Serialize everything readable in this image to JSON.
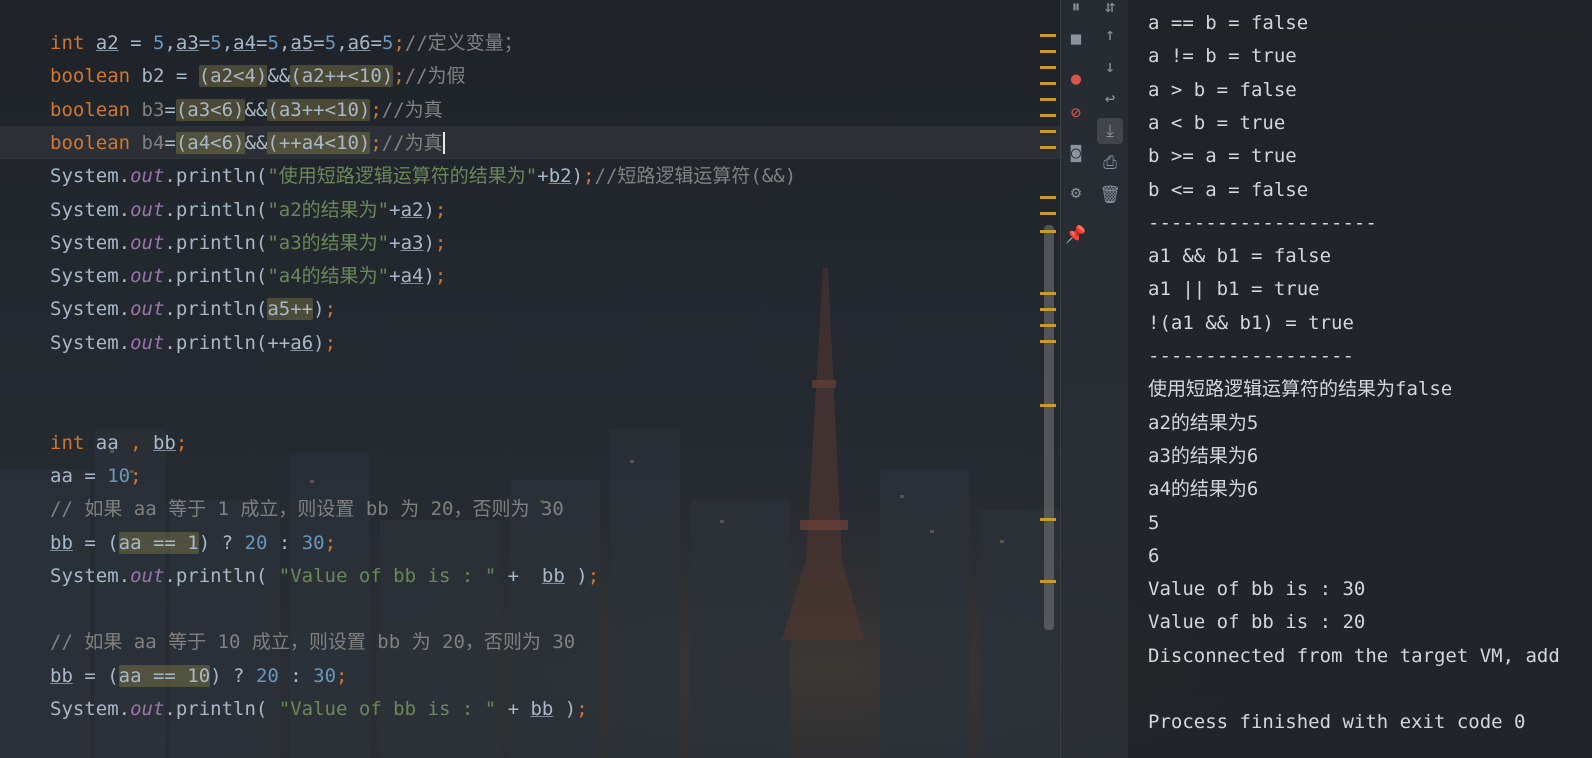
{
  "editor": {
    "lines": [
      {
        "tokens": [
          {
            "t": "int ",
            "c": "kw"
          },
          {
            "t": "a2",
            "c": "ul"
          },
          {
            "t": " = "
          },
          {
            "t": "5",
            "c": "num"
          },
          {
            "t": ","
          },
          {
            "t": "a3",
            "c": "ul"
          },
          {
            "t": "="
          },
          {
            "t": "5",
            "c": "num"
          },
          {
            "t": ","
          },
          {
            "t": "a4",
            "c": "ul"
          },
          {
            "t": "="
          },
          {
            "t": "5",
            "c": "num"
          },
          {
            "t": ","
          },
          {
            "t": "a5",
            "c": "ul"
          },
          {
            "t": "="
          },
          {
            "t": "5",
            "c": "num"
          },
          {
            "t": ","
          },
          {
            "t": "a6",
            "c": "ul"
          },
          {
            "t": "="
          },
          {
            "t": "5",
            "c": "num"
          },
          {
            "t": ";",
            "c": "kw"
          },
          {
            "t": "//定义变量；",
            "c": "cmt"
          }
        ]
      },
      {
        "tokens": [
          {
            "t": "boolean ",
            "c": "kw"
          },
          {
            "t": "b2 = "
          },
          {
            "t": "(a2<4)",
            "c": "hl"
          },
          {
            "t": "&&"
          },
          {
            "t": "(a2++<10)",
            "c": "hl"
          },
          {
            "t": ";",
            "c": "kw"
          },
          {
            "t": "//为假",
            "c": "cmt"
          }
        ]
      },
      {
        "tokens": [
          {
            "t": "boolean ",
            "c": "kw"
          },
          {
            "t": "b3",
            "c": "cmt"
          },
          {
            "t": "="
          },
          {
            "t": "(a3<6)",
            "c": "hl"
          },
          {
            "t": "&&"
          },
          {
            "t": "(a3++<10)",
            "c": "hl"
          },
          {
            "t": ";",
            "c": "kw"
          },
          {
            "t": "//为真",
            "c": "cmt"
          }
        ]
      },
      {
        "tokens": [
          {
            "t": "boolean ",
            "c": "kw"
          },
          {
            "t": "b4",
            "c": "cmt"
          },
          {
            "t": "="
          },
          {
            "t": "(a4<6)",
            "c": "hl"
          },
          {
            "t": "&&"
          },
          {
            "t": "(++a4<10)",
            "c": "hl"
          },
          {
            "t": ";",
            "c": "kw"
          },
          {
            "t": "//为真",
            "c": "cmt"
          },
          {
            "t": "",
            "c": "cursor"
          }
        ]
      },
      {
        "tokens": [
          {
            "t": "System."
          },
          {
            "t": "out",
            "c": "fld"
          },
          {
            "t": ".println("
          },
          {
            "t": "\"使用短路逻辑运算符的结果为\"",
            "c": "str"
          },
          {
            "t": "+"
          },
          {
            "t": "b2",
            "c": "ul"
          },
          {
            "t": ")"
          },
          {
            "t": ";",
            "c": "kw"
          },
          {
            "t": "//短路逻辑运算符(&&)",
            "c": "cmt"
          }
        ]
      },
      {
        "tokens": [
          {
            "t": "System."
          },
          {
            "t": "out",
            "c": "fld"
          },
          {
            "t": ".println("
          },
          {
            "t": "\"a2的结果为\"",
            "c": "str"
          },
          {
            "t": "+"
          },
          {
            "t": "a2",
            "c": "ul"
          },
          {
            "t": ")"
          },
          {
            "t": ";",
            "c": "kw"
          }
        ]
      },
      {
        "tokens": [
          {
            "t": "System."
          },
          {
            "t": "out",
            "c": "fld"
          },
          {
            "t": ".println("
          },
          {
            "t": "\"a3的结果为\"",
            "c": "str"
          },
          {
            "t": "+"
          },
          {
            "t": "a3",
            "c": "ul"
          },
          {
            "t": ")"
          },
          {
            "t": ";",
            "c": "kw"
          }
        ]
      },
      {
        "tokens": [
          {
            "t": "System."
          },
          {
            "t": "out",
            "c": "fld"
          },
          {
            "t": ".println("
          },
          {
            "t": "\"a4的结果为\"",
            "c": "str"
          },
          {
            "t": "+"
          },
          {
            "t": "a4",
            "c": "ul"
          },
          {
            "t": ")"
          },
          {
            "t": ";",
            "c": "kw"
          }
        ]
      },
      {
        "tokens": [
          {
            "t": "System."
          },
          {
            "t": "out",
            "c": "fld"
          },
          {
            "t": ".println("
          },
          {
            "t": "a5++",
            "c": "hl"
          },
          {
            "t": ")"
          },
          {
            "t": ";",
            "c": "kw"
          }
        ]
      },
      {
        "tokens": [
          {
            "t": "System."
          },
          {
            "t": "out",
            "c": "fld"
          },
          {
            "t": ".println(++"
          },
          {
            "t": "a6",
            "c": "ul"
          },
          {
            "t": ")"
          },
          {
            "t": ";",
            "c": "kw"
          }
        ]
      },
      {
        "tokens": []
      },
      {
        "tokens": []
      },
      {
        "tokens": [
          {
            "t": "int ",
            "c": "kw"
          },
          {
            "t": "aa "
          },
          {
            "t": ", ",
            "c": "kw"
          },
          {
            "t": "bb",
            "c": "ul"
          },
          {
            "t": ";",
            "c": "kw"
          }
        ]
      },
      {
        "tokens": [
          {
            "t": "aa = "
          },
          {
            "t": "10",
            "c": "num"
          },
          {
            "t": ";",
            "c": "kw"
          }
        ]
      },
      {
        "tokens": [
          {
            "t": "// 如果 aa 等于 1 成立，则设置 bb 为 20，否则为 30",
            "c": "cmt"
          }
        ]
      },
      {
        "tokens": [
          {
            "t": "bb",
            "c": "ul"
          },
          {
            "t": " = ("
          },
          {
            "t": "aa == 1",
            "c": "hl"
          },
          {
            "t": ") ? "
          },
          {
            "t": "20",
            "c": "num"
          },
          {
            "t": " : "
          },
          {
            "t": "30",
            "c": "num"
          },
          {
            "t": ";",
            "c": "kw"
          }
        ]
      },
      {
        "tokens": [
          {
            "t": "System."
          },
          {
            "t": "out",
            "c": "fld"
          },
          {
            "t": ".println( "
          },
          {
            "t": "\"Value of bb is : \"",
            "c": "str"
          },
          {
            "t": " +  "
          },
          {
            "t": "bb",
            "c": "ul"
          },
          {
            "t": " )"
          },
          {
            "t": ";",
            "c": "kw"
          }
        ]
      },
      {
        "tokens": []
      },
      {
        "tokens": [
          {
            "t": "// 如果 aa 等于 10 成立，则设置 bb 为 20，否则为 30",
            "c": "cmt"
          }
        ]
      },
      {
        "tokens": [
          {
            "t": "bb",
            "c": "ul"
          },
          {
            "t": " = ("
          },
          {
            "t": "aa == 10",
            "c": "hl"
          },
          {
            "t": ") ? "
          },
          {
            "t": "20",
            "c": "num"
          },
          {
            "t": " : "
          },
          {
            "t": "30",
            "c": "num"
          },
          {
            "t": ";",
            "c": "kw"
          }
        ]
      },
      {
        "tokens": [
          {
            "t": "System."
          },
          {
            "t": "out",
            "c": "fld"
          },
          {
            "t": ".println( "
          },
          {
            "t": "\"Value of bb is : \"",
            "c": "str"
          },
          {
            "t": " + "
          },
          {
            "t": "bb",
            "c": "ul"
          },
          {
            "t": " )"
          },
          {
            "t": ";",
            "c": "kw"
          }
        ]
      }
    ]
  },
  "toolbar": {
    "icons": [
      {
        "name": "pause-icon",
        "glyph": "⏸"
      },
      {
        "name": "sort-icon",
        "glyph": "⇵"
      },
      {
        "name": "stop-icon",
        "glyph": "■"
      },
      {
        "name": "up-arrow-icon",
        "glyph": "↑"
      },
      {
        "name": "view-breakpoints-icon",
        "glyph": "●"
      },
      {
        "name": "down-arrow-icon",
        "glyph": "↓"
      },
      {
        "name": "soft-wrap-icon",
        "glyph": "↩"
      },
      {
        "name": "mute-breakpoints-icon",
        "glyph": "⊘"
      },
      {
        "name": "scroll-to-end-icon",
        "glyph": "⤓"
      },
      {
        "name": "camera-icon",
        "glyph": "◙"
      },
      {
        "name": "print-icon",
        "glyph": "⎙"
      },
      {
        "name": "settings-icon",
        "glyph": "⚙"
      },
      {
        "name": "trash-icon",
        "glyph": "🗑"
      },
      {
        "name": "pin-icon",
        "glyph": "📌"
      }
    ],
    "colors": {
      "accent": "#c99a2e",
      "breakpoint": "#d9534f"
    }
  },
  "console": {
    "lines": [
      "a == b = false",
      "a != b = true",
      "a > b = false",
      "a < b = true",
      "b >= a = true",
      "b <= a = false",
      "--------------------",
      "a1 && b1 = false",
      "a1 || b1 = true",
      "!(a1 && b1) = true",
      "------------------",
      "使用短路逻辑运算符的结果为false",
      "a2的结果为5",
      "a3的结果为6",
      "a4的结果为6",
      "5",
      "6",
      "Value of bb is : 30",
      "Value of bb is : 20",
      "Disconnected from the target VM, add",
      "",
      "Process finished with exit code 0"
    ]
  }
}
